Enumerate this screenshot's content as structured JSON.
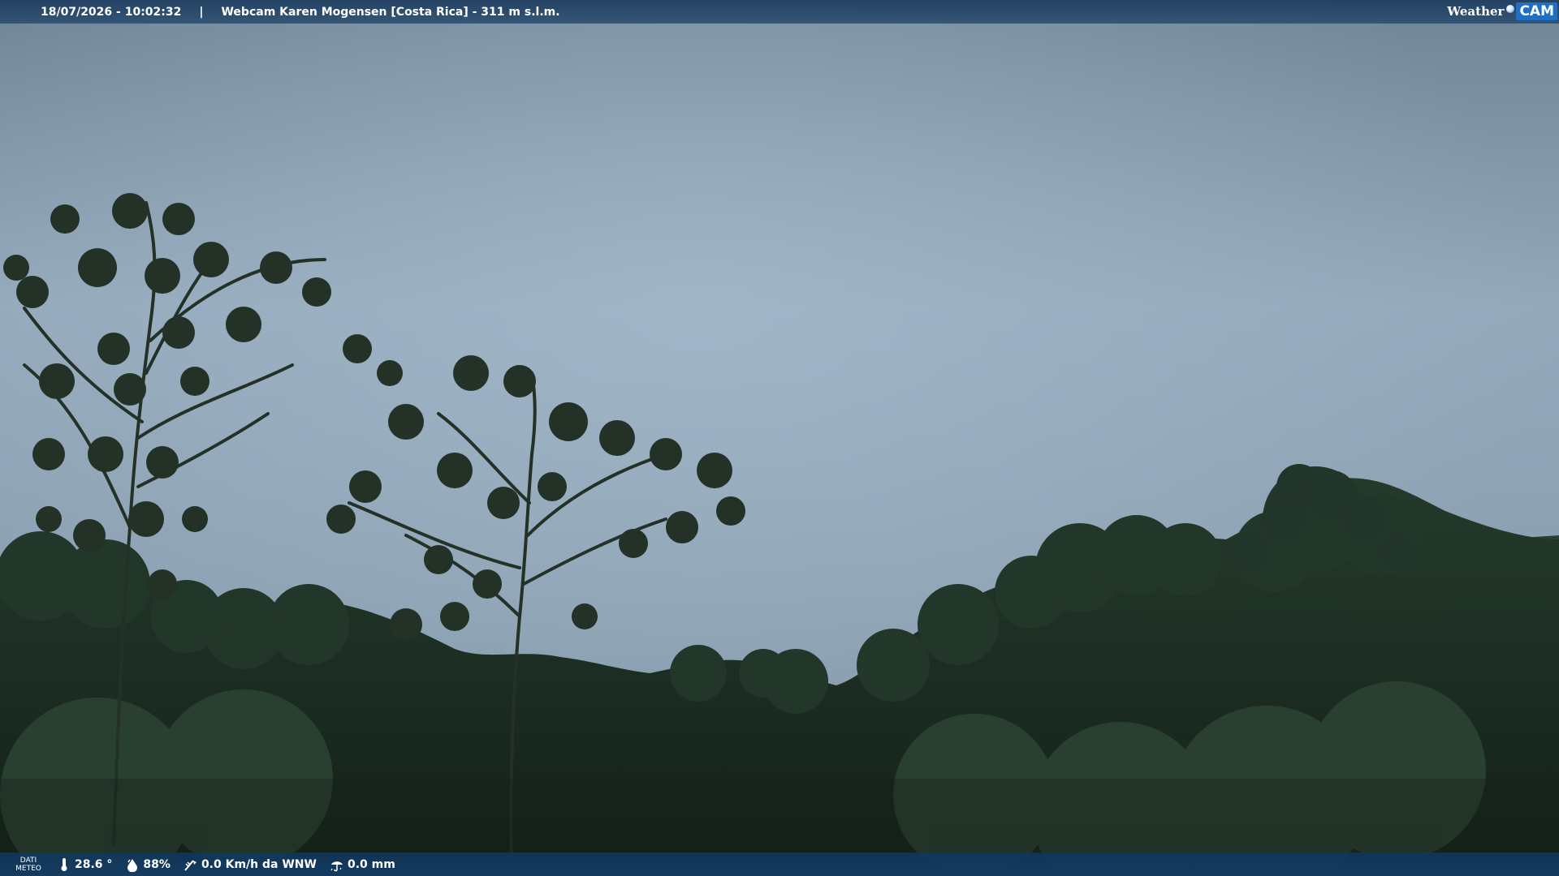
{
  "overlay_top": {
    "datetime": "18/07/2026 - 10:02:32",
    "separator": "|",
    "webcam_title": "Webcam Karen Mogensen [Costa Rica]  - 311 m s.l.m.",
    "logo_left": "Weather",
    "logo_right": "CAM"
  },
  "overlay_bottom": {
    "label_line1": "DATI",
    "label_line2": "METEO",
    "temperature": "28.6 °",
    "humidity": "88%",
    "wind": "0.0 Km/h da WNW",
    "rain": "0.0 mm"
  },
  "icons": [
    "thermometer-icon",
    "humidity-icon",
    "wind-icon",
    "rain-icon"
  ],
  "colors": {
    "sky": "#8fa6b8",
    "foliage": "#1c2a1f",
    "bar": "#1e4f7e",
    "logo_accent": "#1e6fc8"
  }
}
